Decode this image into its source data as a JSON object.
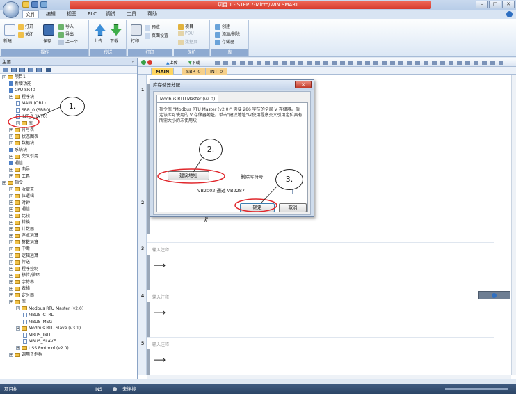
{
  "app": {
    "title": "项目 1 - STEP 7-Micro/WIN SMART"
  },
  "menu": [
    "文件",
    "编辑",
    "视图",
    "PLC",
    "调试",
    "工具",
    "帮助"
  ],
  "ribbon": {
    "groups": [
      {
        "label": "操作",
        "buttons": [
          "新建",
          "打开",
          "关闭",
          "保存",
          "导入",
          "导出",
          "上一个"
        ]
      },
      {
        "label": "传送",
        "buttons": [
          "上传",
          "下载"
        ]
      },
      {
        "label": "打印",
        "buttons": [
          "打印",
          "预览",
          "页面设置"
        ]
      },
      {
        "label": "保护",
        "buttons": [
          "项目",
          "POU",
          "数据页"
        ]
      },
      {
        "label": "库",
        "buttons": [
          "创建",
          "添加/删除",
          "存储器"
        ]
      }
    ]
  },
  "left_pane": {
    "title": "主要"
  },
  "tree": [
    {
      "label": "项目1",
      "indent": 0,
      "kind": "root"
    },
    {
      "label": "新增功能",
      "indent": 1,
      "kind": "item"
    },
    {
      "label": "CPU SR40",
      "indent": 1,
      "kind": "item"
    },
    {
      "label": "程序块",
      "indent": 1,
      "kind": "folder"
    },
    {
      "label": "MAIN (OB1)",
      "indent": 2,
      "kind": "doc"
    },
    {
      "label": "SBR_0 (SBR0)",
      "indent": 2,
      "kind": "doc"
    },
    {
      "label": "INT_0 (INT0)",
      "indent": 2,
      "kind": "doc"
    },
    {
      "label": "库",
      "indent": 2,
      "kind": "folder"
    },
    {
      "label": "符号表",
      "indent": 1,
      "kind": "folder"
    },
    {
      "label": "状态图表",
      "indent": 1,
      "kind": "folder"
    },
    {
      "label": "数据块",
      "indent": 1,
      "kind": "folder"
    },
    {
      "label": "系统块",
      "indent": 1,
      "kind": "item"
    },
    {
      "label": "交叉引用",
      "indent": 1,
      "kind": "folder"
    },
    {
      "label": "通信",
      "indent": 1,
      "kind": "item"
    },
    {
      "label": "向导",
      "indent": 1,
      "kind": "folder"
    },
    {
      "label": "工具",
      "indent": 1,
      "kind": "folder"
    },
    {
      "label": "指令",
      "indent": 0,
      "kind": "folder"
    },
    {
      "label": "收藏夹",
      "indent": 1,
      "kind": "folder"
    },
    {
      "label": "位逻辑",
      "indent": 1,
      "kind": "folder"
    },
    {
      "label": "时钟",
      "indent": 1,
      "kind": "folder"
    },
    {
      "label": "通信",
      "indent": 1,
      "kind": "folder"
    },
    {
      "label": "比较",
      "indent": 1,
      "kind": "folder"
    },
    {
      "label": "转换",
      "indent": 1,
      "kind": "folder"
    },
    {
      "label": "计数器",
      "indent": 1,
      "kind": "folder"
    },
    {
      "label": "浮点运算",
      "indent": 1,
      "kind": "folder"
    },
    {
      "label": "整数运算",
      "indent": 1,
      "kind": "folder"
    },
    {
      "label": "中断",
      "indent": 1,
      "kind": "folder"
    },
    {
      "label": "逻辑运算",
      "indent": 1,
      "kind": "folder"
    },
    {
      "label": "传送",
      "indent": 1,
      "kind": "folder"
    },
    {
      "label": "程序控制",
      "indent": 1,
      "kind": "folder"
    },
    {
      "label": "移位/循环",
      "indent": 1,
      "kind": "folder"
    },
    {
      "label": "字符串",
      "indent": 1,
      "kind": "folder"
    },
    {
      "label": "表格",
      "indent": 1,
      "kind": "folder"
    },
    {
      "label": "定时器",
      "indent": 1,
      "kind": "folder"
    },
    {
      "label": "库",
      "indent": 1,
      "kind": "folder"
    },
    {
      "label": "Modbus RTU Master (v2.0)",
      "indent": 2,
      "kind": "folder"
    },
    {
      "label": "MBUS_CTRL",
      "indent": 3,
      "kind": "doc"
    },
    {
      "label": "MBUS_MSG",
      "indent": 3,
      "kind": "doc"
    },
    {
      "label": "Modbus RTU Slave (v3.1)",
      "indent": 2,
      "kind": "folder"
    },
    {
      "label": "MBUS_INIT",
      "indent": 3,
      "kind": "doc"
    },
    {
      "label": "MBUS_SLAVE",
      "indent": 3,
      "kind": "doc"
    },
    {
      "label": "USS Protocol (v2.0)",
      "indent": 2,
      "kind": "folder"
    },
    {
      "label": "调用子例程",
      "indent": 1,
      "kind": "folder"
    }
  ],
  "editor": {
    "tabs": [
      "MAIN",
      "SBR_0",
      "INT_0"
    ],
    "toolbar": [
      "上传",
      "下载"
    ],
    "networks": [
      {
        "num": "1",
        "comment": ""
      },
      {
        "num": "2",
        "comment": ""
      },
      {
        "num": "3",
        "comment": "输入注释"
      },
      {
        "num": "4",
        "comment": "输入注释"
      },
      {
        "num": "5",
        "comment": "输入注释"
      }
    ]
  },
  "dialog": {
    "title": "库存储器分配",
    "tab": "Modbus RTU Master (v2.0)",
    "description": "指令库 \"Modbus RTU Master (v2.0)\" 需要 286 字节的全局 V 存储器。指定该库可使用的 V 存储器地址。单击\"建议地址\"以使用程序交叉引用定位具有所需大小的未使用块",
    "suggest_button": "建议地址",
    "delete_label": "删除库符号",
    "result_from": "VB2002",
    "result_via": "通过",
    "result_to": "VB2287",
    "ok": "确定",
    "cancel": "取消"
  },
  "callouts": [
    "1.",
    "2.",
    "3."
  ],
  "status": {
    "left": "项目树",
    "ins": "INS",
    "connection": "未连接"
  }
}
